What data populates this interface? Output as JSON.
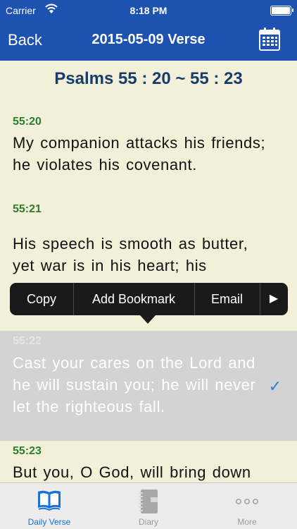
{
  "status_bar": {
    "carrier": "Carrier",
    "time": "8:18 PM"
  },
  "nav": {
    "back_label": "Back",
    "title": "2015-05-09 Verse"
  },
  "passage": "Psalms 55 : 20 ~ 55 : 23",
  "verses": [
    {
      "number": "55:20",
      "text": "My companion attacks his friends; he violates his covenant."
    },
    {
      "number": "55:21",
      "text": "His speech is smooth as butter, yet war is in his heart; his"
    },
    {
      "number": "55:22",
      "text": "Cast your cares on the Lord and he will sustain you; he will never let the righteous fall."
    },
    {
      "number": "55:23",
      "text": "But you, O God, will bring down"
    }
  ],
  "context_menu": {
    "copy": "Copy",
    "add_bookmark": "Add Bookmark",
    "email": "Email",
    "more_arrow": "▶"
  },
  "tabs": [
    {
      "label": "Daily Verse",
      "icon": "book-icon",
      "selected": true
    },
    {
      "label": "Diary",
      "icon": "notebook-icon",
      "selected": false
    },
    {
      "label": "More",
      "icon": "more-dots-icon",
      "selected": false
    }
  ],
  "colors": {
    "nav_bar": "#1e52b0",
    "background": "#f2f0d9",
    "verse_number": "#2d7d2d",
    "passage_title": "#173d6e",
    "selected_tab": "#1b6fd9",
    "check": "#2b7ae0"
  }
}
